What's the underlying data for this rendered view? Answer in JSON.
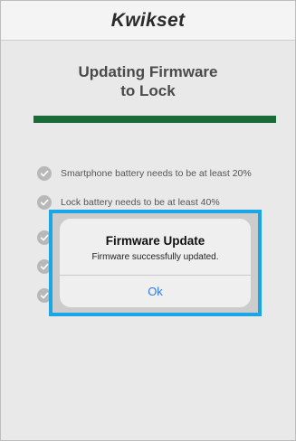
{
  "header": {
    "logo_text": "Kwikset"
  },
  "main": {
    "title_line1": "Updating Firmware",
    "title_line2": "to Lock",
    "progress_fraction": 1.0,
    "progress_color": "#1b6b39",
    "checklist": [
      {
        "label": "Smartphone battery needs to be at least 20%",
        "checked": true
      },
      {
        "label": "Lock battery needs to be at least 40%",
        "checked": true
      },
      {
        "label": "",
        "checked": true
      },
      {
        "label": "",
        "checked": true
      },
      {
        "label": "",
        "checked": true
      }
    ]
  },
  "alert": {
    "title": "Firmware Update",
    "message": "Firmware successfully updated.",
    "button_label": "Ok",
    "highlight_color": "#1aa6e6"
  },
  "icons": {
    "checklist_icon": "checkmark-circle-icon"
  }
}
